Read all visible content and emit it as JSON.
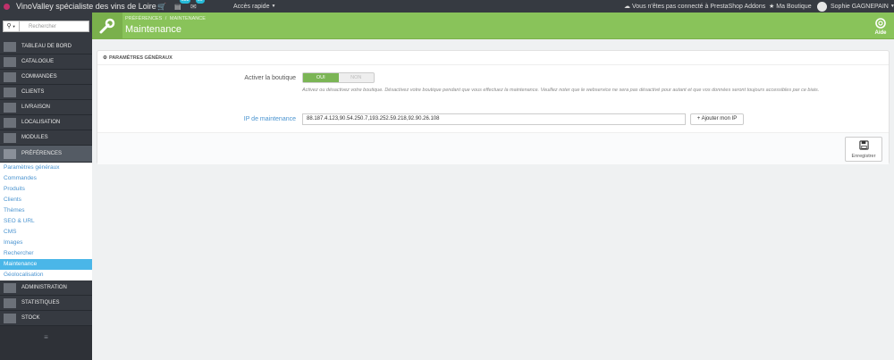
{
  "topbar": {
    "shop_name": "VinoValley spécialiste des vins de Loire",
    "orders_badge": "358",
    "customers_badge": "86",
    "quick_access": "Accès rapide",
    "addons_notice": "Vous n'êtes pas connecté à PrestaShop Addons",
    "my_shop": "Ma Boutique",
    "user_name": "Sophie GAGNEPAIN"
  },
  "sidebar": {
    "search_placeholder": "Rechercher",
    "items": [
      {
        "label": "Tableau de bord",
        "icon": "dashboard-icon"
      },
      {
        "label": "Catalogue",
        "icon": "catalog-icon"
      },
      {
        "label": "Commandes",
        "icon": "orders-icon"
      },
      {
        "label": "Clients",
        "icon": "customers-icon"
      },
      {
        "label": "Livraison",
        "icon": "truck-icon"
      },
      {
        "label": "Localisation",
        "icon": "globe-icon"
      },
      {
        "label": "Modules",
        "icon": "puzzle-icon"
      },
      {
        "label": "Préférences",
        "icon": "wrench-icon"
      }
    ],
    "submenu": [
      "Paramètres généraux",
      "Commandes",
      "Produits",
      "Clients",
      "Thèmes",
      "SEO & URL",
      "CMS",
      "Images",
      "Rechercher",
      "Maintenance",
      "Géolocalisation"
    ],
    "active_sub": "Maintenance",
    "items_after": [
      {
        "label": "Administration",
        "icon": "gear-icon"
      },
      {
        "label": "Statistiques",
        "icon": "stats-icon"
      },
      {
        "label": "Stock",
        "icon": "stock-icon"
      }
    ]
  },
  "pagehead": {
    "breadcrumb_1": "Préférences",
    "breadcrumb_sep": "/",
    "breadcrumb_2": "Maintenance",
    "title": "Maintenance",
    "help_label": "Aide"
  },
  "panel": {
    "heading": "Paramètres généraux",
    "enable_shop_label": "Activer la boutique",
    "switch_on": "Oui",
    "switch_off": "Non",
    "help_text": "Activez ou désactivez votre boutique. Désactivez votre boutique pendant que vous effectuez la maintenance. Veuillez noter que le webservice ne sera pas désactivé pour autant et que vos données seront toujours accessibles par ce biais.",
    "maintenance_ip_label": "IP de maintenance",
    "maintenance_ip_value": "88.187.4.123,90.54.250.7,193.252.59.218,92.90.26.108",
    "add_ip_button": "Ajouter mon IP",
    "save_button": "Enregistrer"
  },
  "colors": {
    "accent_green": "#89c35a",
    "active_blue": "#4ab6e8",
    "sidebar_dark": "#363a41"
  }
}
